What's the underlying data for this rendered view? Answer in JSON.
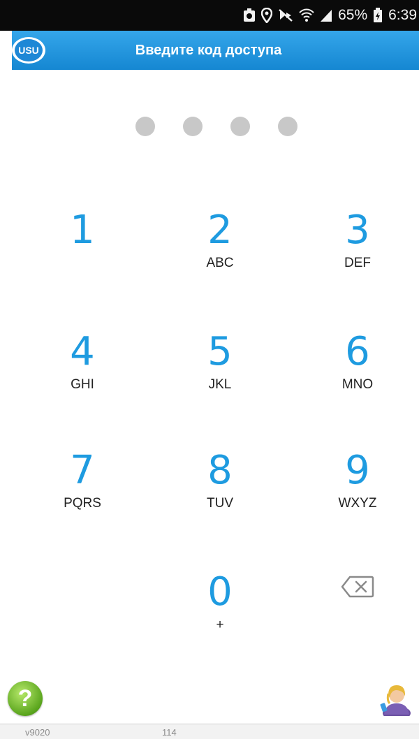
{
  "status_bar": {
    "battery_percent": "65%",
    "time": "6:39",
    "icons": [
      "notification-icon",
      "location-icon",
      "mute-icon",
      "wifi-icon",
      "signal-icon",
      "battery-icon"
    ]
  },
  "app_bar": {
    "logo_text": "USU",
    "title": "Введите код доступа",
    "color": "#1e88d6"
  },
  "pin": {
    "length": 4,
    "entered": 0
  },
  "keypad": {
    "keys": [
      {
        "digit": "1",
        "letters": ""
      },
      {
        "digit": "2",
        "letters": "ABC"
      },
      {
        "digit": "3",
        "letters": "DEF"
      },
      {
        "digit": "4",
        "letters": "GHI"
      },
      {
        "digit": "5",
        "letters": "JKL"
      },
      {
        "digit": "6",
        "letters": "MNO"
      },
      {
        "digit": "7",
        "letters": "PQRS"
      },
      {
        "digit": "8",
        "letters": "TUV"
      },
      {
        "digit": "9",
        "letters": "WXYZ"
      },
      {
        "digit": "0",
        "letters": "+"
      }
    ],
    "backspace_icon": "backspace-icon",
    "digit_color": "#1e9be0"
  },
  "bottom": {
    "help_icon": "help-icon",
    "help_glyph": "?",
    "user_icon": "user-support-icon"
  },
  "footer": {
    "version": "v9020",
    "count": "114"
  }
}
